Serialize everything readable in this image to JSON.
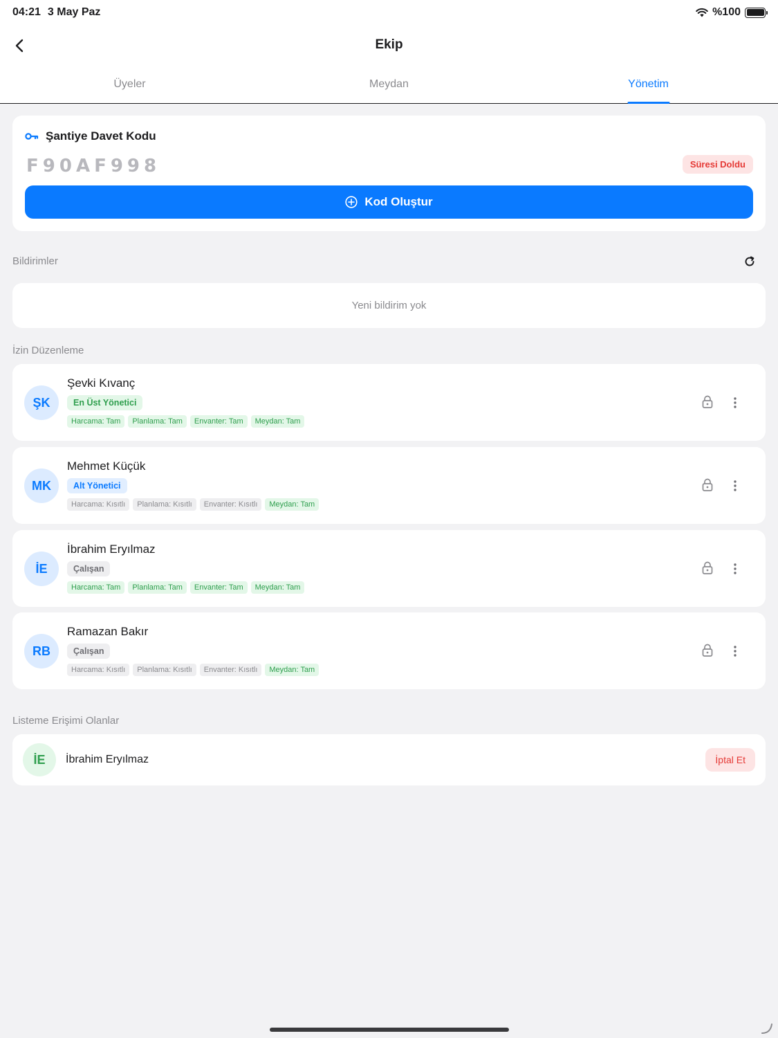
{
  "status_bar": {
    "time": "04:21",
    "date": "3 May Paz",
    "battery": "%100"
  },
  "nav": {
    "title": "Ekip"
  },
  "tabs": [
    {
      "label": "Üyeler",
      "active": false
    },
    {
      "label": "Meydan",
      "active": false
    },
    {
      "label": "Yönetim",
      "active": true
    }
  ],
  "invite": {
    "title": "Şantiye Davet Kodu",
    "code": "F90AF998",
    "status": "Süresi Doldu",
    "create_label": "Kod Oluştur"
  },
  "notifications": {
    "label": "Bildirimler",
    "empty_text": "Yeni bildirim yok"
  },
  "permissions": {
    "label": "İzin Düzenleme",
    "members": [
      {
        "initials": "ŞK",
        "name": "Şevki Kıvanç",
        "role": "En Üst Yönetici",
        "perms": [
          "Harcama: Tam",
          "Planlama: Tam",
          "Envanter: Tam",
          "Meydan: Tam"
        ]
      },
      {
        "initials": "MK",
        "name": "Mehmet Küçük",
        "role": "Alt Yönetici",
        "perms": [
          "Harcama: Kısıtlı",
          "Planlama: Kısıtlı",
          "Envanter: Kısıtlı",
          "Meydan: Tam"
        ]
      },
      {
        "initials": "İE",
        "name": "İbrahim Eryılmaz",
        "role": "Çalışan",
        "perms": [
          "Harcama: Tam",
          "Planlama: Tam",
          "Envanter: Tam",
          "Meydan: Tam"
        ]
      },
      {
        "initials": "RB",
        "name": "Ramazan Bakır",
        "role": "Çalışan",
        "perms": [
          "Harcama: Kısıtlı",
          "Planlama: Kısıtlı",
          "Envanter: Kısıtlı",
          "Meydan: Tam"
        ]
      }
    ]
  },
  "list_access": {
    "label": "Listeme Erişimi Olanlar",
    "users": [
      {
        "initials": "İE",
        "name": "İbrahim Eryılmaz",
        "action": "İptal Et"
      }
    ]
  },
  "icons": [
    "back-chevron-icon",
    "key-icon",
    "plus-circle-icon",
    "refresh-icon",
    "lock-icon",
    "more-vertical-icon",
    "wifi-icon",
    "battery-icon"
  ],
  "colors": {
    "accent": "#0a7aff",
    "danger": "#e53935",
    "success": "#2e9e4d"
  }
}
